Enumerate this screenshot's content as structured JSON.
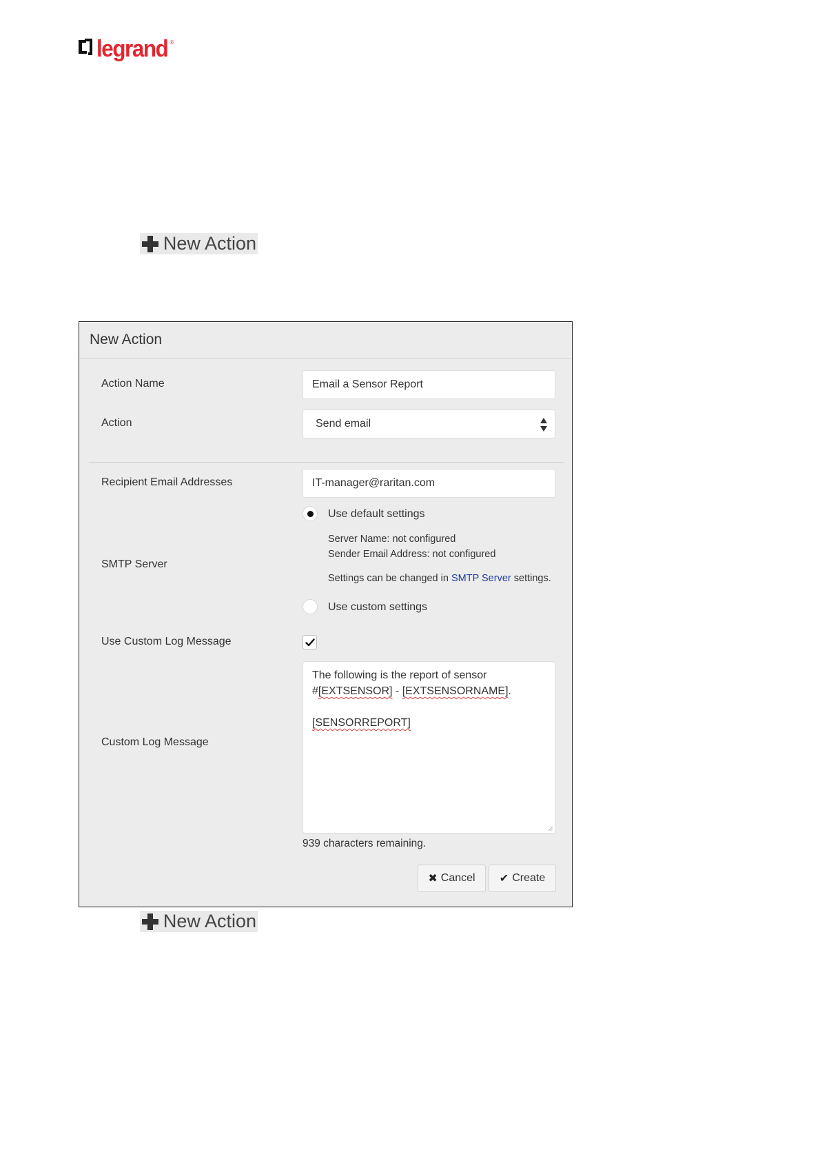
{
  "logo": {
    "text": "legrand",
    "reg_mark": "®",
    "brand_color": "#e3262e"
  },
  "new_action_button": {
    "label": "New Action",
    "icon": "plus-icon"
  },
  "dialog": {
    "title": "New Action",
    "fields": {
      "action_name": {
        "label": "Action Name",
        "value": "Email a Sensor Report"
      },
      "action": {
        "label": "Action",
        "selected": "Send email"
      },
      "recipient": {
        "label": "Recipient Email Addresses",
        "value": "IT-manager@raritan.com"
      },
      "smtp": {
        "label": "SMTP Server",
        "default_option": "Use default settings",
        "server_name": "Server Name: not configured",
        "sender_email": "Sender Email Address: not configured",
        "settings_prefix": "Settings can be changed in ",
        "settings_link": "SMTP Server",
        "settings_suffix": " settings.",
        "custom_option": "Use custom settings",
        "link_color": "#1f3fa3"
      },
      "use_custom_log": {
        "label": "Use Custom Log Message",
        "checked": true
      },
      "custom_log": {
        "label": "Custom Log Message",
        "line1": "The following is the report of sensor",
        "line2_prefix": "#",
        "line2_token1": "[EXTSENSOR]",
        "line2_sep": " - ",
        "line2_token2": "[EXTSENSORNAME]",
        "line2_suffix": ".",
        "line4": "[SENSORREPORT]",
        "remaining": "939 characters remaining."
      }
    },
    "buttons": {
      "cancel": "Cancel",
      "create": "Create"
    }
  }
}
